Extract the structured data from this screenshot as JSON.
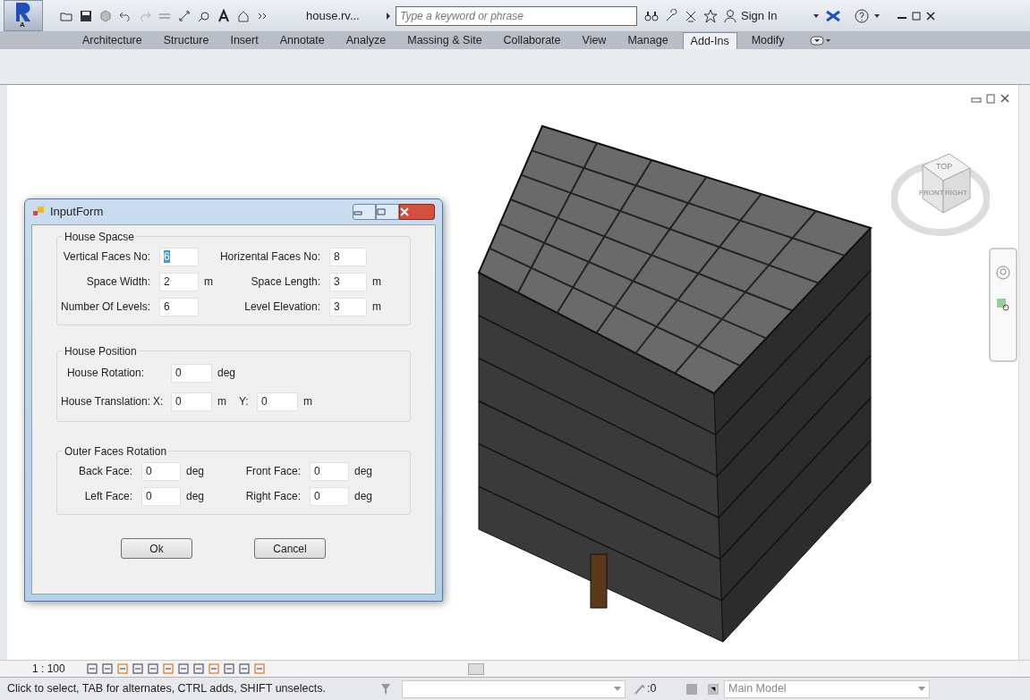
{
  "toolbar": {
    "app_letter": "A",
    "file_title": "house.rv...",
    "search": {
      "placeholder": "Type a keyword or phrase"
    },
    "sign_in": "Sign In"
  },
  "ribbon_tabs": [
    {
      "label": "Architecture",
      "selected": false
    },
    {
      "label": "Structure",
      "selected": false
    },
    {
      "label": "Insert",
      "selected": false
    },
    {
      "label": "Annotate",
      "selected": false
    },
    {
      "label": "Analyze",
      "selected": false
    },
    {
      "label": "Massing & Site",
      "selected": false
    },
    {
      "label": "Collaborate",
      "selected": false
    },
    {
      "label": "View",
      "selected": false
    },
    {
      "label": "Manage",
      "selected": false
    },
    {
      "label": "Add-Ins",
      "selected": true
    },
    {
      "label": "Modify",
      "selected": false
    }
  ],
  "view_cube": {
    "top": "TOP",
    "front": "FRONT",
    "right": "RIGHT"
  },
  "dialog": {
    "title": "InputForm",
    "groups": [
      {
        "title": "House Spacse",
        "rows": [
          [
            {
              "kind": "label",
              "text": "Vertical Faces No:"
            },
            {
              "kind": "input",
              "value": "6",
              "focused": true
            },
            {
              "kind": "gap"
            },
            {
              "kind": "label",
              "text": "Horizental Faces No:"
            },
            {
              "kind": "input",
              "value": "8",
              "focused": false
            }
          ],
          [
            {
              "kind": "label",
              "text": "Space Width:"
            },
            {
              "kind": "input",
              "value": "2",
              "focused": false
            },
            {
              "kind": "unit",
              "text": "m"
            },
            {
              "kind": "label",
              "text": "Space Length:"
            },
            {
              "kind": "input",
              "value": "3",
              "focused": false
            },
            {
              "kind": "unit",
              "text": "m"
            }
          ],
          [
            {
              "kind": "label",
              "text": "Number Of Levels:"
            },
            {
              "kind": "input",
              "value": "6",
              "focused": false
            },
            {
              "kind": "gap"
            },
            {
              "kind": "label",
              "text": "Level Elevation:"
            },
            {
              "kind": "input",
              "value": "3",
              "focused": false
            },
            {
              "kind": "unit",
              "text": "m"
            }
          ]
        ]
      },
      {
        "title": "House Position",
        "rows": [
          [
            {
              "kind": "label",
              "text": "House Rotation:"
            },
            {
              "kind": "gap"
            },
            {
              "kind": "input",
              "value": "0",
              "focused": false
            },
            {
              "kind": "unit",
              "text": "deg"
            }
          ],
          [
            {
              "kind": "label",
              "text": "House Translation:"
            },
            {
              "kind": "label",
              "text": "X:"
            },
            {
              "kind": "input",
              "value": "0",
              "focused": false
            },
            {
              "kind": "unit",
              "text": "m"
            },
            {
              "kind": "label",
              "text": "Y:"
            },
            {
              "kind": "input",
              "value": "0",
              "focused": false
            },
            {
              "kind": "unit",
              "text": "m"
            }
          ]
        ]
      },
      {
        "title": "Outer Faces Rotation",
        "rows": [
          [
            {
              "kind": "label",
              "text": "Back Face:"
            },
            {
              "kind": "input",
              "value": "0",
              "focused": false
            },
            {
              "kind": "unit",
              "text": "deg"
            },
            {
              "kind": "label",
              "text": "Front Face:"
            },
            {
              "kind": "input",
              "value": "0",
              "focused": false
            },
            {
              "kind": "unit",
              "text": "deg"
            }
          ],
          [
            {
              "kind": "label",
              "text": "Left Face:"
            },
            {
              "kind": "input",
              "value": "0",
              "focused": false
            },
            {
              "kind": "unit",
              "text": "deg"
            },
            {
              "kind": "label",
              "text": "Right Face:"
            },
            {
              "kind": "input",
              "value": "0",
              "focused": false
            },
            {
              "kind": "unit",
              "text": "deg"
            }
          ]
        ]
      }
    ],
    "buttons": [
      "Ok",
      "Cancel"
    ]
  },
  "view_bar": {
    "scale": "1 : 100"
  },
  "status_bar": {
    "message": "Click to select, TAB for alternates, CTRL adds, SHIFT unselects.",
    "selection_count": ":0",
    "model": "Main Model"
  }
}
